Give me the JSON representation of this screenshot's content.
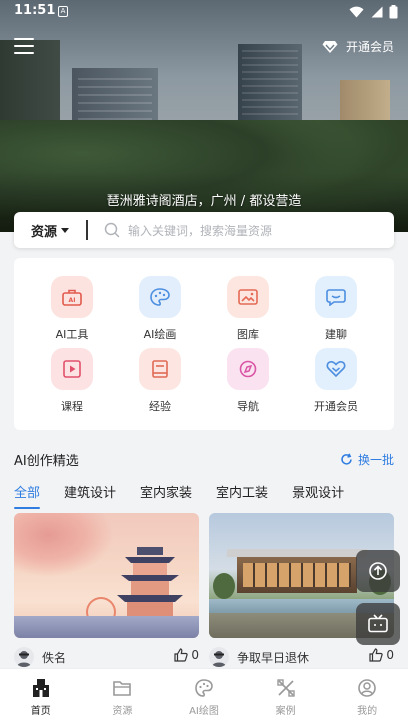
{
  "status_bar": {
    "time": "11:51",
    "notification_badge": "A"
  },
  "header": {
    "vip_label": "开通会员"
  },
  "hero": {
    "caption": "琶洲雅诗阁酒店，广州 / 都设营造"
  },
  "search": {
    "scope": "资源",
    "placeholder": "输入关键词，搜索海量资源"
  },
  "quick_grid": [
    {
      "label": "AI工具",
      "icon": "ai-tool-icon",
      "color": "#fde3e0",
      "fg": "#e25a4e"
    },
    {
      "label": "AI绘画",
      "icon": "palette-icon",
      "color": "#e3eefc",
      "fg": "#4d8fe0"
    },
    {
      "label": "图库",
      "icon": "gallery-icon",
      "color": "#fde6e0",
      "fg": "#e56a55"
    },
    {
      "label": "建聊",
      "icon": "chat-icon",
      "color": "#e2effc",
      "fg": "#4d8fe0"
    },
    {
      "label": "课程",
      "icon": "video-course-icon",
      "color": "#fde2e4",
      "fg": "#e0506a"
    },
    {
      "label": "经验",
      "icon": "book-icon",
      "color": "#fde6e2",
      "fg": "#e06a55"
    },
    {
      "label": "导航",
      "icon": "compass-icon",
      "color": "#fbe2f0",
      "fg": "#d955a5"
    },
    {
      "label": "开通会员",
      "icon": "vip-heart-icon",
      "color": "#e2effc",
      "fg": "#4d8fe0"
    }
  ],
  "section": {
    "title": "AI创作精选",
    "refresh_label": "换一批"
  },
  "tabs": [
    {
      "label": "全部",
      "active": true
    },
    {
      "label": "建筑设计",
      "active": false
    },
    {
      "label": "室内家装",
      "active": false
    },
    {
      "label": "室内工装",
      "active": false
    },
    {
      "label": "景观设计",
      "active": false
    }
  ],
  "cards": [
    {
      "author": "佚名",
      "likes": "0"
    },
    {
      "author": "争取早日退休",
      "likes": "0"
    }
  ],
  "bottom_nav": [
    {
      "label": "首页",
      "active": true
    },
    {
      "label": "资源",
      "active": false
    },
    {
      "label": "AI绘图",
      "active": false
    },
    {
      "label": "案例",
      "active": false
    },
    {
      "label": "我的",
      "active": false
    }
  ],
  "colors": {
    "accent": "#2f7de1",
    "background": "#f2f3f5"
  }
}
